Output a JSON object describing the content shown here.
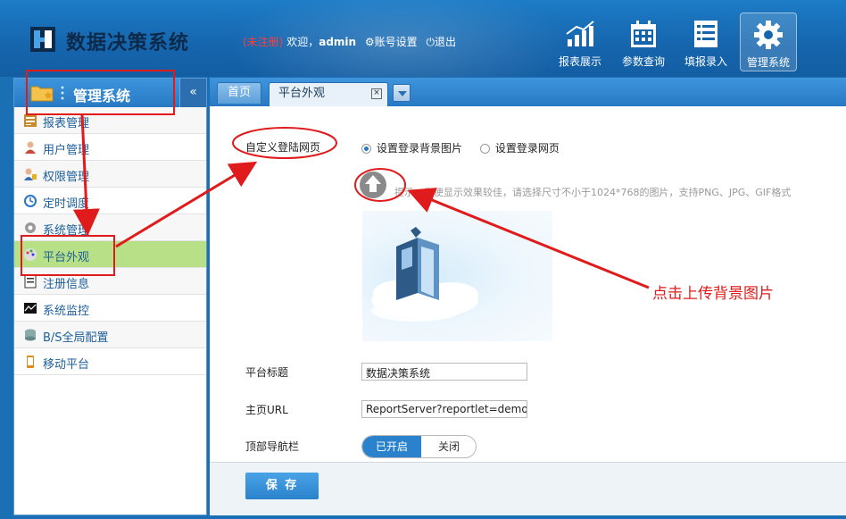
{
  "header": {
    "app_title": "数据决策系统",
    "unregistered": "(未注册)",
    "welcome": "欢迎，",
    "user": "admin",
    "account_settings": "账号设置",
    "logout": "退出",
    "nav": [
      {
        "label": "报表展示",
        "icon": "chart-up-icon"
      },
      {
        "label": "参数查询",
        "icon": "calendar-icon"
      },
      {
        "label": "填报录入",
        "icon": "list-icon"
      },
      {
        "label": "管理系统",
        "icon": "gear-icon",
        "active": true
      }
    ]
  },
  "sidebar": {
    "title": "管理系统",
    "collapse_glyph": "«",
    "items": [
      {
        "label": "报表管理",
        "icon": "report-icon"
      },
      {
        "label": "用户管理",
        "icon": "user-icon"
      },
      {
        "label": "权限管理",
        "icon": "permission-icon"
      },
      {
        "label": "定时调度",
        "icon": "clock-icon"
      },
      {
        "label": "系统管理",
        "icon": "gear-icon"
      },
      {
        "label": "平台外观",
        "icon": "palette-icon",
        "active": true
      },
      {
        "label": "注册信息",
        "icon": "register-icon"
      },
      {
        "label": "系统监控",
        "icon": "monitor-icon"
      },
      {
        "label": "B/S全局配置",
        "icon": "database-icon"
      },
      {
        "label": "移动平台",
        "icon": "mobile-icon"
      }
    ]
  },
  "tabs": {
    "home": "首页",
    "current": "平台外观",
    "close_glyph": "×"
  },
  "form": {
    "custom_login_label": "自定义登陆网页",
    "radio_bg_image": "设置登录背景图片",
    "radio_web_page": "设置登录网页",
    "hint": "提示：为使显示效果较佳，请选择尺寸不小于1024*768的图片，支持PNG、JPG、GIF格式",
    "platform_title_label": "平台标题",
    "platform_title_value": "数据决策系统",
    "home_url_label": "主页URL",
    "home_url_value": "ReportServer?reportlet=demo...",
    "top_nav_label": "顶部导航栏",
    "toggle_on": "已开启",
    "toggle_off": "关闭",
    "save": "保 存"
  },
  "annotation": {
    "text": "点击上传背景图片",
    "color": "#e01b1b"
  }
}
